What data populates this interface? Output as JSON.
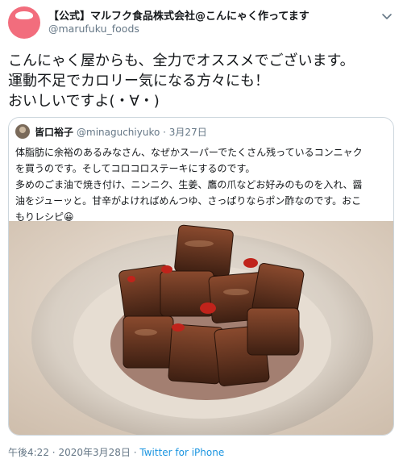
{
  "account": {
    "display_name": "【公式】マルフク食品株式会社@こんにゃく作ってます",
    "handle": "@marufuku_foods",
    "avatar_text": "MARUFUKU\nFOODS\nこんにゃく"
  },
  "tweet": {
    "lines": [
      "こんにゃく屋からも、全力でオススメでございます。",
      "運動不足でカロリー気になる方々にも！",
      "おいしいですよ(・∀・)"
    ]
  },
  "quoted": {
    "name": "皆口裕子",
    "handle": "@minaguchiyuko",
    "separator": "·",
    "date": "3月27日",
    "lines": [
      "体脂肪に余裕のあるみなさん、なぜかスーパーでたくさん残っているコンニャク",
      "を買うのです。そしてコロコロステーキにするのです。",
      "多めのごま油で焼き付け、ニンニク、生姜、鷹の爪などお好みのものを入れ、醤",
      "油をジューッと。甘辛がよければめんつゆ、さっぱりならポン酢なのです。おこ",
      "もりレシピ😀"
    ],
    "photo_icon": "photo-konjac-steak"
  },
  "footer": {
    "time": "午後4:22",
    "separator": "·",
    "date": "2020年3月28日",
    "source": "Twitter for iPhone"
  },
  "colors": {
    "text": "#14171a",
    "secondary": "#657786",
    "link": "#1b95e0",
    "border": "#ccd6dd",
    "avatar_bg": "#f26d7d"
  }
}
